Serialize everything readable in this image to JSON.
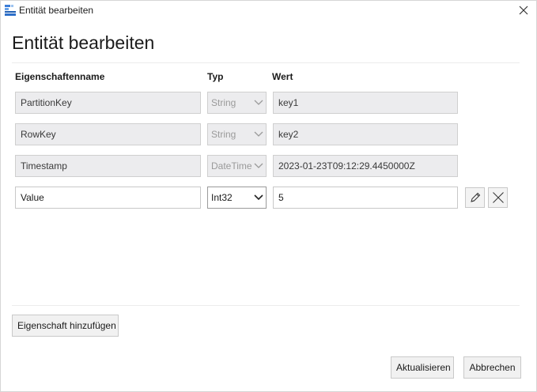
{
  "window": {
    "title": "Entität bearbeiten",
    "icon": "storage-table-icon",
    "close_icon": "close-icon"
  },
  "dialog": {
    "heading": "Entität bearbeiten",
    "columns": {
      "name": "Eigenschaftenname",
      "type": "Typ",
      "value": "Wert"
    },
    "properties": [
      {
        "name": "PartitionKey",
        "type": "String",
        "value": "key1",
        "editable": false
      },
      {
        "name": "RowKey",
        "type": "String",
        "value": "key2",
        "editable": false
      },
      {
        "name": "Timestamp",
        "type": "DateTime",
        "value": "2023-01-23T09:12:29.4450000Z",
        "editable": false
      },
      {
        "name": "Value",
        "type": "Int32",
        "value": "5",
        "editable": true
      }
    ],
    "row_actions": {
      "edit_icon": "pencil-icon",
      "delete_icon": "x-icon"
    },
    "add_property_label": "Eigenschaft hinzufügen",
    "update_label": "Aktualisieren",
    "cancel_label": "Abbrechen"
  },
  "colors": {
    "readonly_bg": "#ececee",
    "border": "#cfcfcf",
    "button_bg": "#f1f1f1"
  }
}
